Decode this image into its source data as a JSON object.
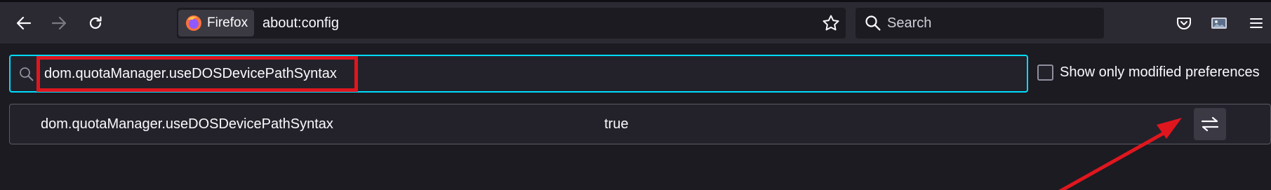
{
  "browser": {
    "identity_label": "Firefox",
    "url": "about:config",
    "search_placeholder": "Search"
  },
  "config": {
    "filter_value": "dom.quotaManager.useDOSDevicePathSyntax",
    "show_modified_label": "Show only modified preferences",
    "show_modified_checked": false,
    "preferences": [
      {
        "name": "dom.quotaManager.useDOSDevicePathSyntax",
        "value": "true"
      }
    ]
  },
  "annotations": {
    "highlight_color": "#e0161e",
    "arrow_color": "#e0161e"
  },
  "colors": {
    "accent_focus": "#00ddff",
    "toolbar_bg": "#2b2a33",
    "page_bg": "#1c1b22"
  }
}
